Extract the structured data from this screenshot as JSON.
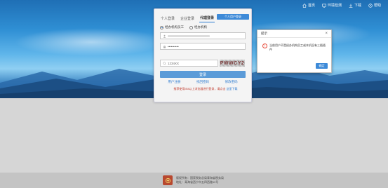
{
  "topnav": {
    "items": [
      {
        "icon": "home-icon",
        "label": "首页"
      },
      {
        "icon": "monitor-icon",
        "label": "环境检测"
      },
      {
        "icon": "download-icon",
        "label": "下载"
      },
      {
        "icon": "help-icon",
        "label": "帮助"
      }
    ]
  },
  "login": {
    "tabs": [
      "个人登录",
      "企业登录",
      "代理登录"
    ],
    "active_tab": "代理登录",
    "tab_button": "个人用户登录",
    "radios": [
      "经办机构员工",
      "经办机构"
    ],
    "password_placeholder": "••••••••••",
    "captcha_value": "1234XX",
    "captcha_image_text": "PWWCY2",
    "submit": "登录",
    "links": [
      "用户注册",
      "找回密码",
      "修改密码"
    ],
    "notice": "推荐使用IE8以上浏览器进行登录，请点击",
    "notice_link": "这里下载"
  },
  "dialog": {
    "title": "提示",
    "message": "当前用户不是经办机构员工或本机没有三插插件",
    "ok": "确定"
  },
  "footer": {
    "line1": "版权所有：国家税务总局青海省税务局",
    "line2": "地址：青海省西宁市五四西路11号"
  },
  "colors": {
    "accent": "#3d8ad8",
    "error": "#c0392b",
    "hero_top": "#1f6fb5"
  }
}
